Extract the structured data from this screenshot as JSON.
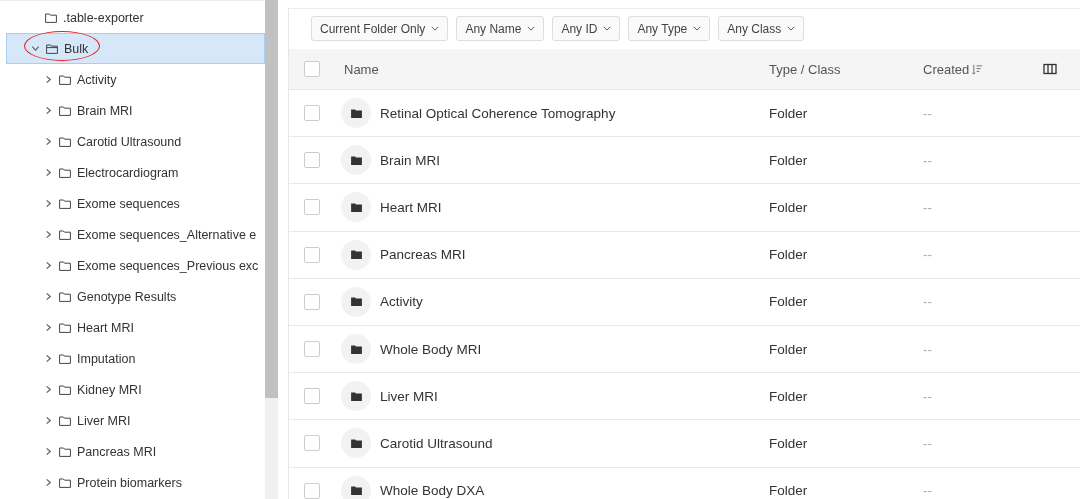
{
  "tree": {
    "items": [
      {
        "label": ".table-exporter",
        "expandable": false,
        "expanded": false,
        "selected": false,
        "circled": false
      },
      {
        "label": "Bulk",
        "expandable": true,
        "expanded": true,
        "selected": true,
        "circled": true,
        "children": [
          {
            "label": "Activity",
            "expandable": true,
            "expanded": false,
            "selected": false,
            "circled": false
          },
          {
            "label": "Brain MRI",
            "expandable": true,
            "expanded": false,
            "selected": false,
            "circled": false
          },
          {
            "label": "Carotid Ultrasound",
            "expandable": true,
            "expanded": false,
            "selected": false,
            "circled": false
          },
          {
            "label": "Electrocardiogram",
            "expandable": true,
            "expanded": false,
            "selected": false,
            "circled": false
          },
          {
            "label": "Exome sequences",
            "expandable": true,
            "expanded": false,
            "selected": false,
            "circled": false
          },
          {
            "label": "Exome sequences_Alternative e",
            "expandable": true,
            "expanded": false,
            "selected": false,
            "circled": false
          },
          {
            "label": "Exome sequences_Previous exc",
            "expandable": true,
            "expanded": false,
            "selected": false,
            "circled": false
          },
          {
            "label": "Genotype Results",
            "expandable": true,
            "expanded": false,
            "selected": false,
            "circled": false
          },
          {
            "label": "Heart MRI",
            "expandable": true,
            "expanded": false,
            "selected": false,
            "circled": false
          },
          {
            "label": "Imputation",
            "expandable": true,
            "expanded": false,
            "selected": false,
            "circled": false
          },
          {
            "label": "Kidney MRI",
            "expandable": true,
            "expanded": false,
            "selected": false,
            "circled": false
          },
          {
            "label": "Liver MRI",
            "expandable": true,
            "expanded": false,
            "selected": false,
            "circled": false
          },
          {
            "label": "Pancreas MRI",
            "expandable": true,
            "expanded": false,
            "selected": false,
            "circled": false
          },
          {
            "label": "Protein biomarkers",
            "expandable": true,
            "expanded": false,
            "selected": false,
            "circled": false
          }
        ]
      }
    ]
  },
  "filters": [
    "Current Folder Only",
    "Any Name",
    "Any ID",
    "Any Type",
    "Any Class"
  ],
  "table": {
    "select_all": {
      "checked": false
    },
    "columns": [
      "Name",
      "Type / Class",
      "Created"
    ],
    "rows": [
      {
        "name": "Retinal Optical Coherence Tomography",
        "type": "Folder",
        "created": "--",
        "checked": false
      },
      {
        "name": "Brain MRI",
        "type": "Folder",
        "created": "--",
        "checked": false
      },
      {
        "name": "Heart MRI",
        "type": "Folder",
        "created": "--",
        "checked": false
      },
      {
        "name": "Pancreas MRI",
        "type": "Folder",
        "created": "--",
        "checked": false
      },
      {
        "name": "Activity",
        "type": "Folder",
        "created": "--",
        "checked": false
      },
      {
        "name": "Whole Body MRI",
        "type": "Folder",
        "created": "--",
        "checked": false
      },
      {
        "name": "Liver MRI",
        "type": "Folder",
        "created": "--",
        "checked": false
      },
      {
        "name": "Carotid Ultrasound",
        "type": "Folder",
        "created": "--",
        "checked": false
      },
      {
        "name": "Whole Body DXA",
        "type": "Folder",
        "created": "--",
        "checked": false
      }
    ]
  }
}
